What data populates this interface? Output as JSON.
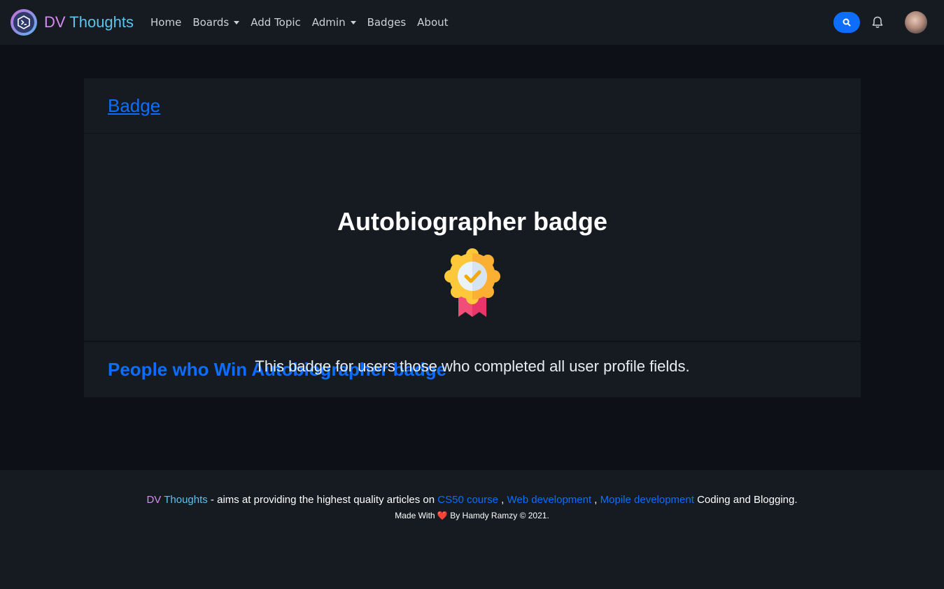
{
  "brand": {
    "part1": "DV",
    "part2": "Thoughts",
    "logo_icon": "terminal-hexagon-icon"
  },
  "nav": {
    "items": [
      {
        "label": "Home",
        "dropdown": false
      },
      {
        "label": "Boards",
        "dropdown": true
      },
      {
        "label": "Add Topic",
        "dropdown": false
      },
      {
        "label": "Admin",
        "dropdown": true
      },
      {
        "label": "Badges",
        "dropdown": false
      },
      {
        "label": "About",
        "dropdown": false
      }
    ],
    "search_icon": "search-icon",
    "notification_icon": "bell-icon",
    "avatar": "user-avatar"
  },
  "card": {
    "header_link": "Badge",
    "badge_title": "Autobiographer badge",
    "badge_icon": "award-ribbon-icon",
    "badge_description": "This badge for users those who completed all user profile fields.",
    "winners_heading": "People who Win Autobiographer badge"
  },
  "footer": {
    "brand_dv": "DV",
    "brand_thoughts": "Thoughts",
    "text_1": " - aims at providing the highest quality articles on ",
    "link_1": "CS50 course",
    "sep_1": " , ",
    "link_2": "Web development",
    "sep_2": " , ",
    "link_3": "Mopile development",
    "text_2": " Coding and Blogging.",
    "made_with": "Made With",
    "heart": "❤️",
    "credit": "By Hamdy Ramzy © 2021."
  },
  "colors": {
    "page_bg": "#0d1117",
    "panel_bg": "#161b22",
    "accent": "#0d6efd",
    "brand_pink": "#d58bf0",
    "brand_cyan": "#5cc3f0"
  }
}
